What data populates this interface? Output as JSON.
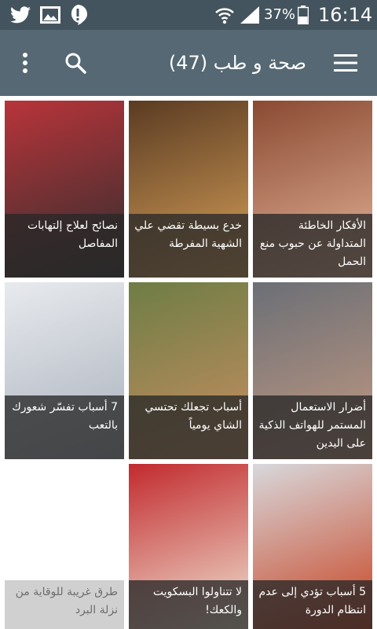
{
  "status_bar": {
    "battery_percent": "37%",
    "time": "16:14",
    "icons": [
      "twitter-icon",
      "image-icon",
      "alert-icon",
      "wifi-icon",
      "signal-icon",
      "battery-icon"
    ]
  },
  "toolbar": {
    "title": "صحة و طب (47)",
    "icons": [
      "menu-icon",
      "search-icon",
      "hamburger-icon"
    ]
  },
  "articles": [
    {
      "title": "الأفكار الخاطئة المتداولة عن حبوب منع الحمل",
      "image_colors": [
        "#8a4a32",
        "#e6b69a"
      ]
    },
    {
      "title": "خدع بسيطة تقضي علي الشهية المفرطة",
      "image_colors": [
        "#5a3b22",
        "#d9a25a"
      ]
    },
    {
      "title": "نصائح لعلاج إلتهابات المفاصل",
      "image_colors": [
        "#b8343a",
        "#2e2e2e"
      ]
    },
    {
      "title": "أضرار الاستعمال المستمر للهواتف الذكية على اليدين",
      "image_colors": [
        "#6b6f76",
        "#c49a82"
      ]
    },
    {
      "title": "أسباب تجعلك تحتسي الشاي يومياً",
      "image_colors": [
        "#6e7d45",
        "#c98f62"
      ]
    },
    {
      "title": "7 أسباب تفسّر شعورك بالتعب",
      "image_colors": [
        "#e8eaee",
        "#a8b0bb"
      ]
    },
    {
      "title": "5 أسباب تؤدي إلى عدم انتظام الدورة",
      "image_colors": [
        "#d8d8dc",
        "#c7401e"
      ]
    },
    {
      "title": "لا تتناولوا البسكويت والكعك!",
      "image_colors": [
        "#c22a2e",
        "#f0e6d4"
      ]
    },
    {
      "title": "طرق غريبة للوقاية من نزلة البرد",
      "image_colors": [
        "#ffffff",
        "#ffffff"
      ]
    }
  ]
}
